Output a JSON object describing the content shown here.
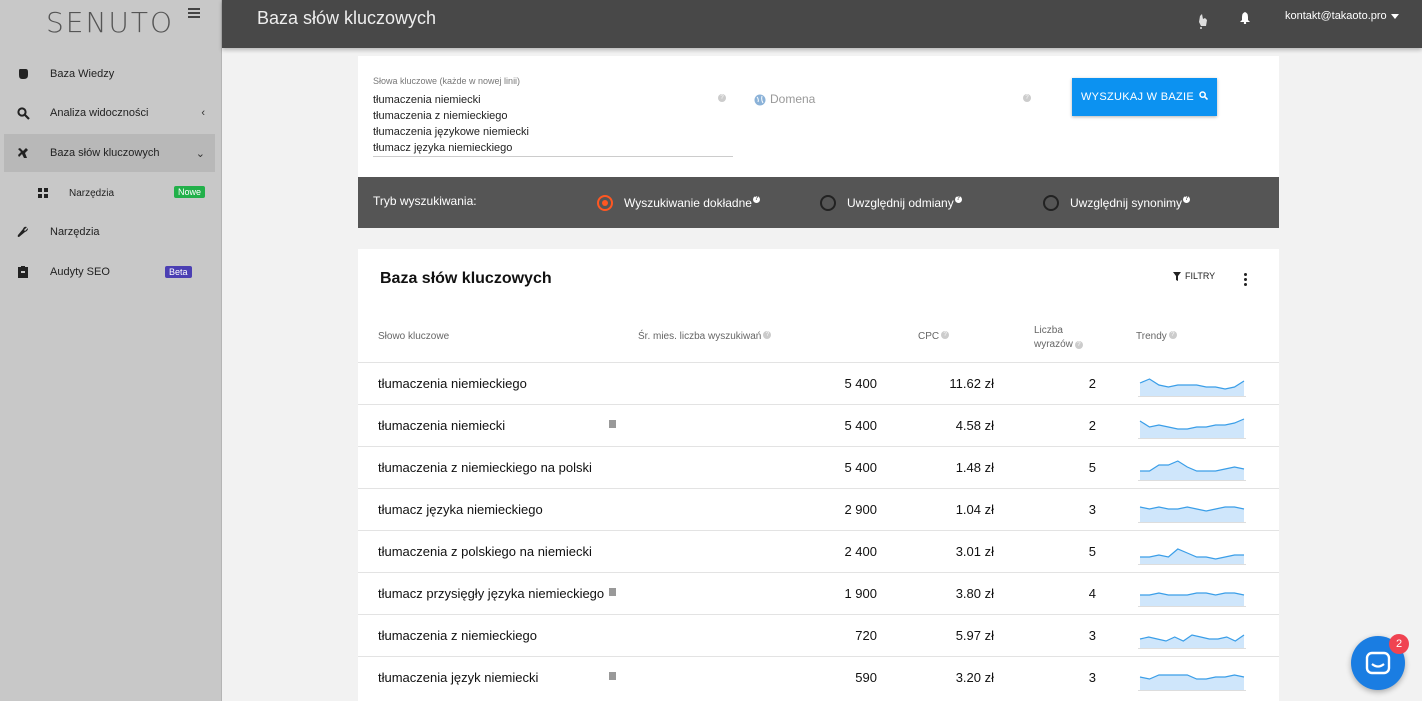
{
  "app": {
    "logo": "SENUTO"
  },
  "sidebar": {
    "items": [
      {
        "label": "Baza Wiedzy",
        "icon": "brain-icon"
      },
      {
        "label": "Analiza widoczności",
        "icon": "search-icon",
        "chevron": "‹"
      },
      {
        "label": "Baza słów kluczowych",
        "icon": "key-icon",
        "chevron": "⌄"
      },
      {
        "label": "Narzędzia",
        "icon": "grid-icon",
        "badge": "Nowe"
      },
      {
        "label": "Narzędzia",
        "icon": "wrench-icon"
      },
      {
        "label": "Audyty SEO",
        "icon": "clipboard-icon",
        "badge": "Beta"
      }
    ]
  },
  "header": {
    "title": "Baza słów kluczowych",
    "user": "kontakt@takaoto.pro"
  },
  "search": {
    "keywords_label": "Słowa kluczowe (każde w nowej linii)",
    "keywords": [
      "tłumaczenia niemiecki",
      "tłumaczenia z niemieckiego",
      "tłumaczenia językowe niemiecki",
      "tłumacz języka niemieckiego"
    ],
    "domain_placeholder": "Domena",
    "button_label": "WYSZUKAJ W BAZIE"
  },
  "mode": {
    "label": "Tryb wyszukiwania:",
    "options": [
      {
        "label": "Wyszukiwanie dokładne",
        "checked": true
      },
      {
        "label": "Uwzględnij odmiany",
        "checked": false
      },
      {
        "label": "Uwzględnij synonimy",
        "checked": false
      }
    ]
  },
  "results": {
    "title": "Baza słów kluczowych",
    "filter_label": "FILTRY",
    "columns": {
      "keyword": "Słowo kluczowe",
      "volume": "Śr. mies. liczba wyszukiwań",
      "cpc": "CPC",
      "words_line1": "Liczba",
      "words_line2": "wyrazów",
      "trends": "Trendy"
    },
    "rows": [
      {
        "keyword": "tłumaczenia niemieckiego",
        "volume": "5 400",
        "cpc": "11.62 zł",
        "words": "2",
        "flag": false,
        "trend": [
          6,
          8,
          5,
          4,
          5,
          5,
          5,
          4,
          4,
          3,
          4,
          7
        ]
      },
      {
        "keyword": "tłumaczenia niemiecki",
        "volume": "5 400",
        "cpc": "4.58 zł",
        "words": "2",
        "flag": true,
        "trend": [
          8,
          5,
          6,
          5,
          4,
          4,
          5,
          5,
          6,
          6,
          7,
          9
        ]
      },
      {
        "keyword": "tłumaczenia z niemieckiego na polski",
        "volume": "5 400",
        "cpc": "1.48 zł",
        "words": "5",
        "flag": false,
        "trend": [
          4,
          4,
          7,
          7,
          9,
          6,
          4,
          4,
          4,
          5,
          6,
          5
        ]
      },
      {
        "keyword": "tłumacz języka niemieckiego",
        "volume": "2 900",
        "cpc": "1.04 zł",
        "words": "3",
        "flag": false,
        "trend": [
          7,
          6,
          7,
          6,
          6,
          7,
          6,
          5,
          6,
          7,
          7,
          6
        ]
      },
      {
        "keyword": "tłumaczenia z polskiego na niemiecki",
        "volume": "2 400",
        "cpc": "3.01 zł",
        "words": "5",
        "flag": false,
        "trend": [
          3,
          3,
          4,
          3,
          7,
          5,
          3,
          3,
          2,
          3,
          4,
          4
        ]
      },
      {
        "keyword": "tłumacz przysięgły języka niemieckiego",
        "volume": "1 900",
        "cpc": "3.80 zł",
        "words": "4",
        "flag": true,
        "trend": [
          5,
          5,
          6,
          5,
          5,
          5,
          6,
          6,
          5,
          6,
          6,
          5
        ]
      },
      {
        "keyword": "tłumaczenia z niemieckiego",
        "volume": "720",
        "cpc": "5.97 zł",
        "words": "3",
        "flag": false,
        "trend": [
          4,
          5,
          4,
          3,
          5,
          3,
          6,
          5,
          4,
          4,
          5,
          3,
          6
        ]
      },
      {
        "keyword": "tłumaczenia język niemiecki",
        "volume": "590",
        "cpc": "3.20 zł",
        "words": "3",
        "flag": true,
        "trend": [
          6,
          5,
          7,
          7,
          7,
          7,
          5,
          5,
          6,
          6,
          7,
          6
        ]
      }
    ]
  },
  "chat": {
    "unread": "2"
  }
}
